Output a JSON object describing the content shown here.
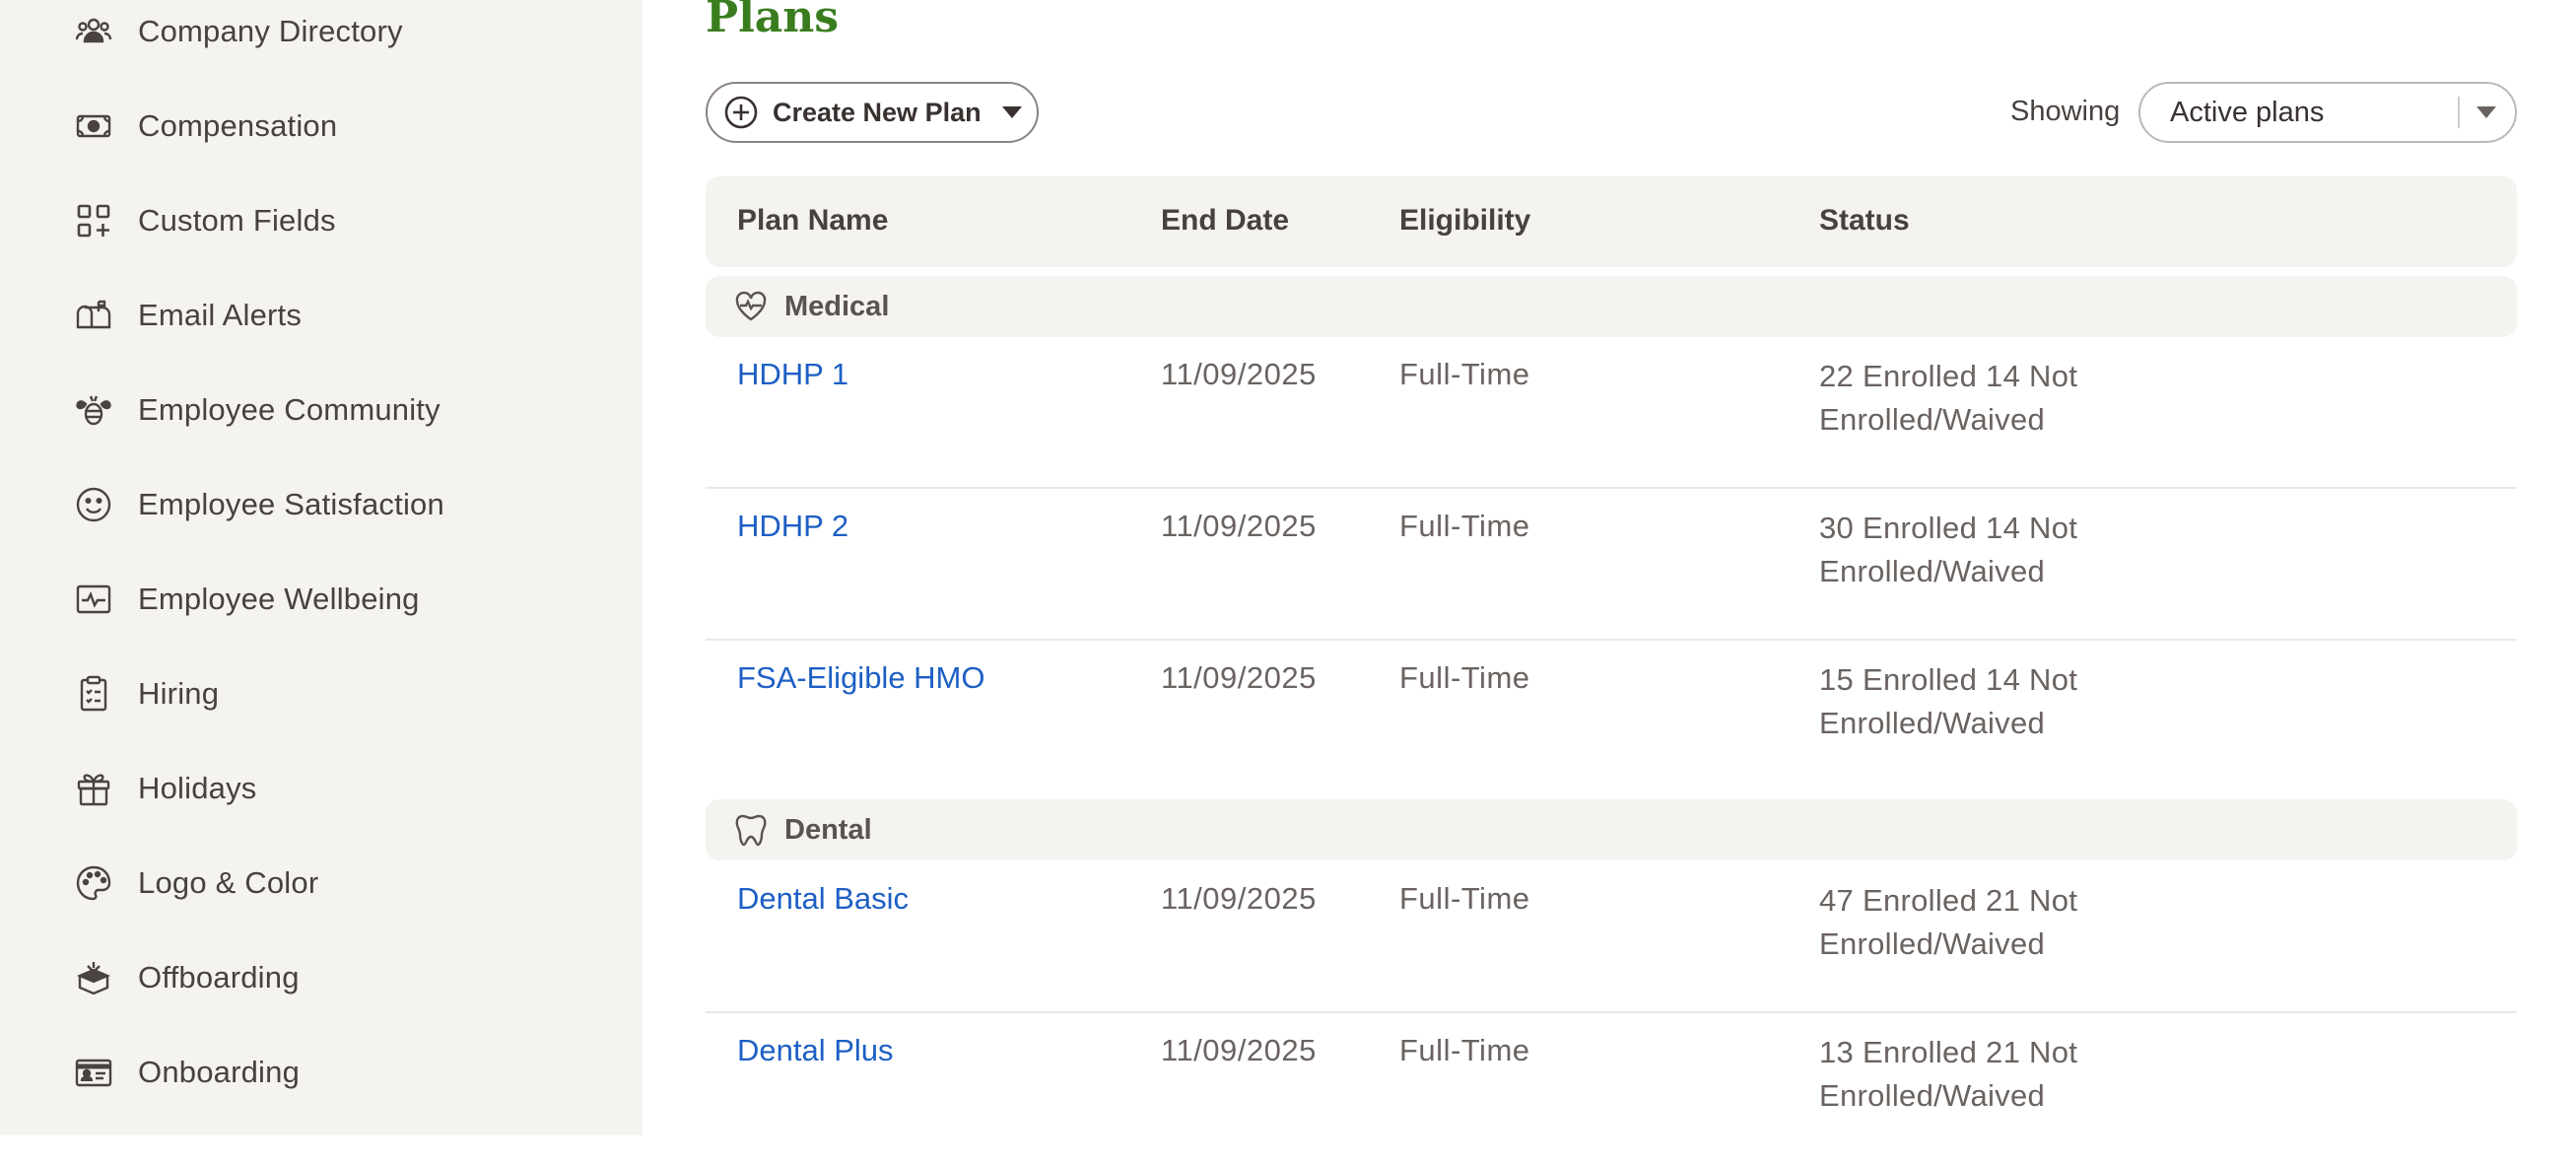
{
  "sidebar": {
    "items": [
      {
        "label": "Company Directory",
        "icon": "people-icon"
      },
      {
        "label": "Compensation",
        "icon": "money-icon"
      },
      {
        "label": "Custom Fields",
        "icon": "custom-fields-icon"
      },
      {
        "label": "Email Alerts",
        "icon": "mailbox-icon"
      },
      {
        "label": "Employee Community",
        "icon": "bee-icon"
      },
      {
        "label": "Employee Satisfaction",
        "icon": "smile-icon"
      },
      {
        "label": "Employee Wellbeing",
        "icon": "wellbeing-icon"
      },
      {
        "label": "Hiring",
        "icon": "clipboard-icon"
      },
      {
        "label": "Holidays",
        "icon": "gift-icon"
      },
      {
        "label": "Logo & Color",
        "icon": "palette-icon"
      },
      {
        "label": "Offboarding",
        "icon": "offboarding-icon"
      },
      {
        "label": "Onboarding",
        "icon": "id-card-icon"
      }
    ]
  },
  "main": {
    "title": "Plans",
    "create_button_label": "Create New Plan",
    "showing_label": "Showing",
    "filter_value": "Active plans",
    "columns": [
      "Plan Name",
      "End Date",
      "Eligibility",
      "Status"
    ],
    "groups": [
      {
        "name": "Medical",
        "icon": "heartbeat-icon",
        "plans": [
          {
            "name": "HDHP 1",
            "end_date": "11/09/2025",
            "eligibility": "Full-Time",
            "status_line1": "22 Enrolled 14 Not",
            "status_line2": "Enrolled/Waived"
          },
          {
            "name": "HDHP 2",
            "end_date": "11/09/2025",
            "eligibility": "Full-Time",
            "status_line1": "30 Enrolled 14 Not",
            "status_line2": "Enrolled/Waived"
          },
          {
            "name": "FSA-Eligible HMO",
            "end_date": "11/09/2025",
            "eligibility": "Full-Time",
            "status_line1": "15 Enrolled 14 Not",
            "status_line2": "Enrolled/Waived"
          }
        ]
      },
      {
        "name": "Dental",
        "icon": "tooth-icon",
        "plans": [
          {
            "name": "Dental Basic",
            "end_date": "11/09/2025",
            "eligibility": "Full-Time",
            "status_line1": "47 Enrolled 21 Not",
            "status_line2": "Enrolled/Waived"
          },
          {
            "name": "Dental Plus",
            "end_date": "11/09/2025",
            "eligibility": "Full-Time",
            "status_line1": "13 Enrolled 21 Not",
            "status_line2": "Enrolled/Waived"
          }
        ]
      }
    ]
  },
  "colors": {
    "sidebar_bg": "#f4f3f0",
    "title_green": "#3a7d1f",
    "link_blue": "#1d5fc4",
    "text_gray": "#6a6360"
  }
}
